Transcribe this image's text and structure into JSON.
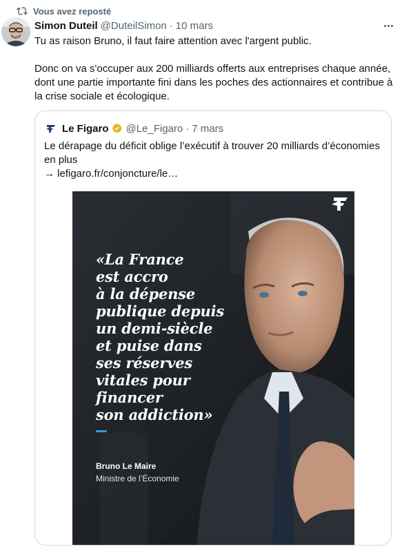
{
  "repost": {
    "label": "Vous avez reposté",
    "icon": "repost-icon"
  },
  "tweet": {
    "author_name": "Simon Duteil",
    "handle": "@DuteilSimon",
    "separator": "·",
    "time": "10 mars",
    "paragraphs": [
      "Tu as raison Bruno,  il faut faire attention avec l'argent public.",
      "Donc on va s'occuper aux 200 milliards offerts aux entreprises chaque année, dont une partie importante fini dans les poches des actionnaires et contribue à la crise sociale et écologique."
    ]
  },
  "quote": {
    "author_name": "Le Figaro",
    "handle": "@Le_Figaro",
    "separator": "·",
    "time": "7 mars",
    "text": "Le dérapage du déficit oblige l’exécutif à trouver 20 milliards d’économies en plus",
    "link": "→ lefigaro.fr/conjoncture/le…",
    "image": {
      "quote_lines": [
        "«La France",
        "est accro",
        "à la dépense",
        "publique depuis",
        "un demi-siècle",
        "et puise dans",
        "ses réserves",
        "vitales pour",
        "financer",
        "son addiction»"
      ],
      "speaker_name": "Bruno Le Maire",
      "speaker_role": "Ministre de l’Économie"
    }
  },
  "colors": {
    "text": "#0f1419",
    "secondary": "#536471",
    "border": "#cfd9de",
    "verified": "#e2b719",
    "image_accent": "#2d9ce0"
  }
}
